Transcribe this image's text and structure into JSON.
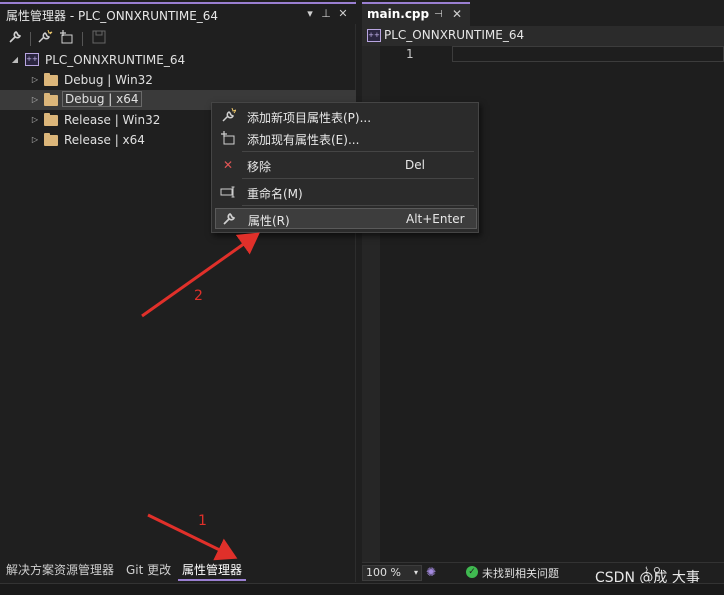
{
  "left_panel": {
    "title": "属性管理器 - PLC_ONNXRUNTIME_64",
    "title_controls": [
      "chevron-down-icon",
      "pin-icon",
      "close-icon"
    ],
    "toolbar_icons": [
      "wrench-icon",
      "add-new-sheet-icon",
      "add-existing-sheet-icon",
      "save-icon"
    ]
  },
  "tree": {
    "project": "PLC_ONNXRUNTIME_64",
    "configs": [
      {
        "label": "Debug | Win32"
      },
      {
        "label": "Debug | x64",
        "selected": true
      },
      {
        "label": "Release | Win32"
      },
      {
        "label": "Release | x64"
      }
    ]
  },
  "context_menu": {
    "items": [
      {
        "label": "添加新项目属性表(P)...",
        "shortcut": "",
        "icon": "add-new-property-sheet-icon"
      },
      {
        "label": "添加现有属性表(E)...",
        "shortcut": "",
        "icon": "add-existing-property-sheet-icon"
      },
      {
        "label": "移除",
        "shortcut": "Del",
        "icon": "remove-x-icon"
      },
      {
        "label": "重命名(M)",
        "shortcut": "",
        "icon": "rename-icon"
      },
      {
        "label": "属性(R)",
        "shortcut": "Alt+Enter",
        "icon": "wrench-icon",
        "highlighted": true
      }
    ]
  },
  "bottom_tabs": [
    {
      "label": "解决方案资源管理器",
      "active": false
    },
    {
      "label": "Git 更改",
      "active": false
    },
    {
      "label": "属性管理器",
      "active": true
    }
  ],
  "editor": {
    "tab_label": "main.cpp",
    "nav_label": "PLC_ONNXRUNTIME_64",
    "line_number": "1",
    "status": {
      "zoom": "100 %",
      "issues": "未找到相关问题"
    }
  },
  "watermark": "CSDN @成 大事",
  "annotations": [
    {
      "number": "1"
    },
    {
      "number": "2"
    }
  ],
  "colors": {
    "accent": "#9a7fd1",
    "folder": "#dcb67a",
    "annotation_red": "#e0302a",
    "ok_green": "#3fb950",
    "remove_red": "#e05555"
  }
}
